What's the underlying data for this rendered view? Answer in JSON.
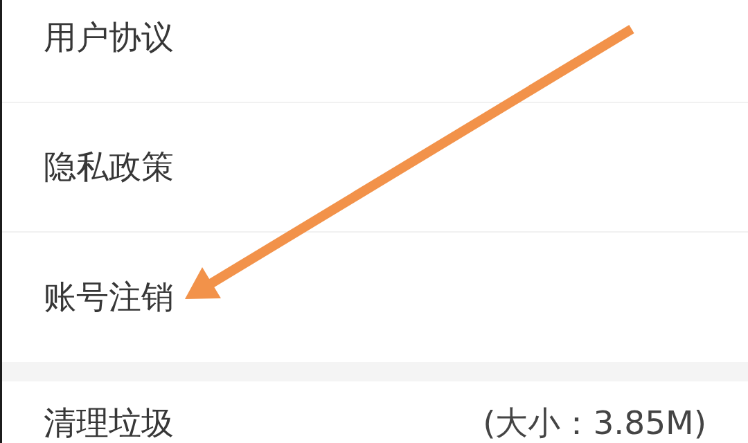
{
  "settings_groups": [
    {
      "items": [
        {
          "label": "用户协议",
          "arrow": false
        },
        {
          "label": "隐私政策",
          "arrow": false
        },
        {
          "label": "账号注销",
          "arrow": true
        }
      ]
    },
    {
      "items": [
        {
          "label": "清理垃圾",
          "value": "(大小：3.85M)",
          "arrow": false
        }
      ]
    }
  ]
}
